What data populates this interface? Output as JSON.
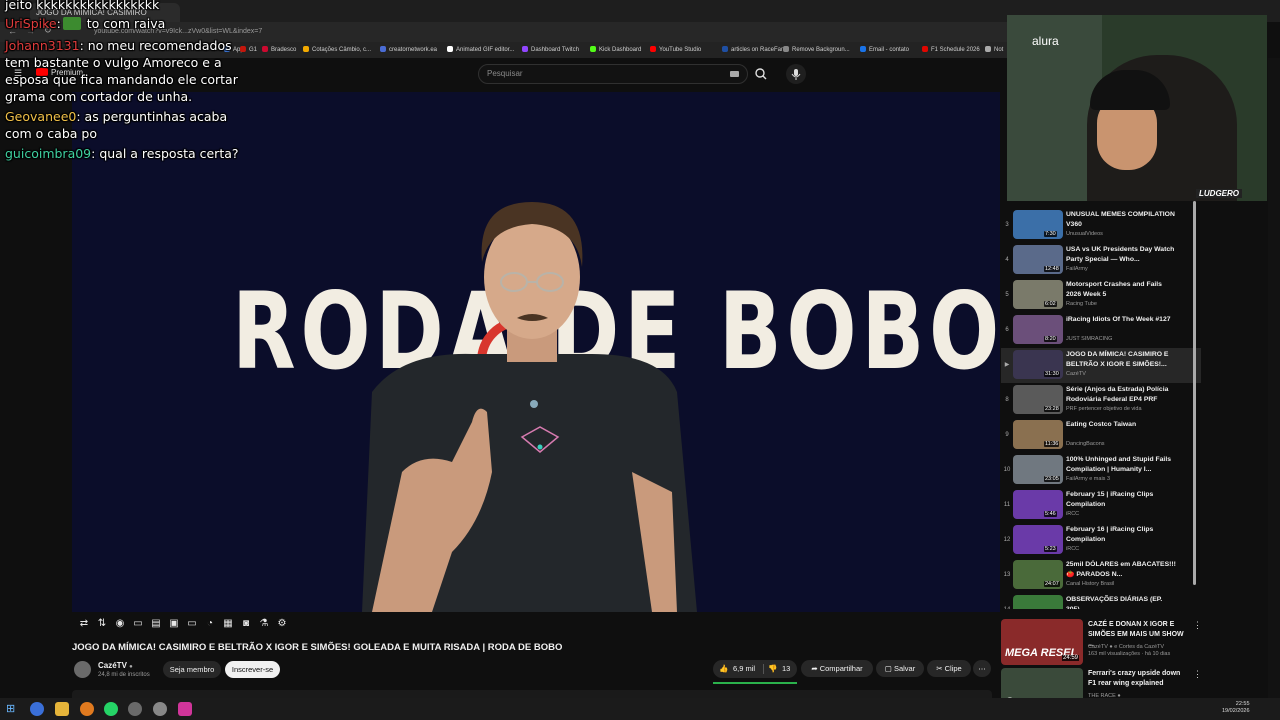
{
  "browser": {
    "tab_title": "JOGO DA MÍMICA! CASIMIRO",
    "url": "youtube.com/watch?v=v9Ick...zVw0&list=WL&index=7",
    "bookmarks": [
      {
        "label": "App",
        "color": "#4285f4"
      },
      {
        "label": "G1",
        "color": "#c4170c"
      },
      {
        "label": "Bradesco",
        "color": "#cc092f"
      },
      {
        "label": "Cotações Câmbio, c...",
        "color": "#f2a900"
      },
      {
        "label": "creatornetwork.ea",
        "color": "#4a6cd4"
      },
      {
        "label": "Animated GIF editor...",
        "color": "#ffffff"
      },
      {
        "label": "Dashboard Twitch",
        "color": "#9146ff"
      },
      {
        "label": "Kick Dashboard",
        "color": "#53fc18"
      },
      {
        "label": "YouTube Studio",
        "color": "#ff0000"
      },
      {
        "label": "articles on RaceFans",
        "color": "#1f4fa3"
      },
      {
        "label": "Remove Backgroun...",
        "color": "#888888"
      },
      {
        "label": "Email - contato",
        "color": "#1a73e8"
      },
      {
        "label": "F1 Schedule 2026",
        "color": "#e10600"
      },
      {
        "label": "Not",
        "color": "#aaaaaa"
      }
    ]
  },
  "youtube": {
    "logo_text": "Premium",
    "search_placeholder": "Pesquisar"
  },
  "video": {
    "bg_text": "RODA DE BOBO",
    "title": "JOGO DA MÍMICA! CASIMIRO E BELTRÃO X IGOR E SIMÕES! GOLEADA E MUITA RISADA | RODA DE BOBO",
    "channel": "CazéTV",
    "subscribers": "24,8 mi de inscritos",
    "member_label": "Seja membro",
    "subscribe_label": "Inscrever-se",
    "likes": "6,9 mil",
    "dislikes": "13",
    "share_label": "Compartilhar",
    "save_label": "Salvar",
    "clip_label": "Clipe",
    "like_ratio": 0.998
  },
  "chat": [
    {
      "user": "",
      "color": "#ffffff",
      "text": "jeito kkkkkkkkkkkkkkkkk"
    },
    {
      "user": "UriSpike",
      "color": "#e03c3c",
      "text": " to com raiva",
      "emote": true
    },
    {
      "user": "Johann3131",
      "color": "#e03c3c",
      "text": ": no meu recomendados"
    },
    {
      "user": "",
      "color": "#ffffff",
      "text": "tem bastante o vulgo Amoreco e a"
    },
    {
      "user": "",
      "color": "#ffffff",
      "text": "esposa que fica mandando ele cortar"
    },
    {
      "user": "",
      "color": "#ffffff",
      "text": "grama com cortador de unha."
    },
    {
      "user": "Geovanee0",
      "color": "#f0c048",
      "text": ": as perguntinhas acaba"
    },
    {
      "user": "",
      "color": "#ffffff",
      "text": "com o caba po"
    },
    {
      "user": "guicoimbra09",
      "color": "#3fd0a0",
      "text": ": qual a resposta certa?"
    }
  ],
  "webcam": {
    "label": "LUDGERO",
    "brand": "alura"
  },
  "playlist": [
    {
      "num": "3",
      "title": "UNUSUAL MEMES COMPILATION V360",
      "channel": "UnusualVideos",
      "duration": "7:30",
      "color": "#3b6fa8"
    },
    {
      "num": "4",
      "title": "USA vs UK Presidents Day Watch Party Special — Who...",
      "channel": "FailArmy",
      "duration": "12:48",
      "color": "#5a6a8a"
    },
    {
      "num": "5",
      "title": "Motorsport Crashes and Fails 2026 Week 5",
      "channel": "Racing Tube",
      "duration": "6:02",
      "color": "#7a7a6a"
    },
    {
      "num": "6",
      "title": "iRacing Idiots Of The Week #127",
      "channel": "JUST SIMRACING",
      "duration": "8:20",
      "color": "#6b4f7a"
    },
    {
      "num": "▶",
      "title": "JOGO DA MÍMICA! CASIMIRO E BELTRÃO X IGOR E SIMÕES!...",
      "channel": "CazéTV",
      "duration": "31:30",
      "color": "#3a3550",
      "active": true
    },
    {
      "num": "8",
      "title": "Série (Anjos da Estrada) Polícia Rodoviária Federal EP4 PRF",
      "channel": "PRF pertencer objetivo de vida",
      "duration": "23:28",
      "color": "#5a5a5a"
    },
    {
      "num": "9",
      "title": "Eating Costco Taiwan",
      "channel": "DancingBacons",
      "duration": "11:36",
      "color": "#8a7050"
    },
    {
      "num": "10",
      "title": "100% Unhinged and Stupid Fails Compilation | Humanity I...",
      "channel": "FailArmy e mais 3",
      "duration": "23:05",
      "color": "#707880"
    },
    {
      "num": "11",
      "title": "February 15 | iRacing Clips Compilation",
      "channel": "iRCC",
      "duration": "5:46",
      "color": "#6a3aa8"
    },
    {
      "num": "12",
      "title": "February 16 | iRacing Clips Compilation",
      "channel": "iRCC",
      "duration": "5:23",
      "color": "#6a3aa8"
    },
    {
      "num": "13",
      "title": "25mil DÓLARES em ABACATES!!! 🍅 PARADOS N...",
      "channel": "Canal History Brasil",
      "duration": "24:07",
      "color": "#4a6a3a"
    },
    {
      "num": "14",
      "title": "OBSERVAÇÕES DIÁRIAS (EP. 305)",
      "channel": "",
      "duration": "",
      "color": "#3a7a3a"
    }
  ],
  "related": [
    {
      "title": "CAZÉ E DONAN X IGOR E SIMÕES EM MAIS UM SHOW ...",
      "channel": "CazéTV ● e Cortes da CazéTV",
      "stats": "163 mil visualizações · há 10 dias",
      "duration": "24:59",
      "thumb_text": "MEGA RESEI",
      "color": "#8a2a2a"
    },
    {
      "title": "Ferrari's crazy upside down F1 rear wing explained",
      "channel": "THE RACE ●",
      "stats": "",
      "duration": "",
      "thumb_text": "Crazy",
      "color": "#3a4a3a"
    }
  ],
  "taskbar": {
    "time": "22:55",
    "date": "19/02/2026"
  },
  "colors": {
    "accent": "#ff0000",
    "like_bar": "#2bb24c",
    "bg": "#0f0f0f"
  }
}
